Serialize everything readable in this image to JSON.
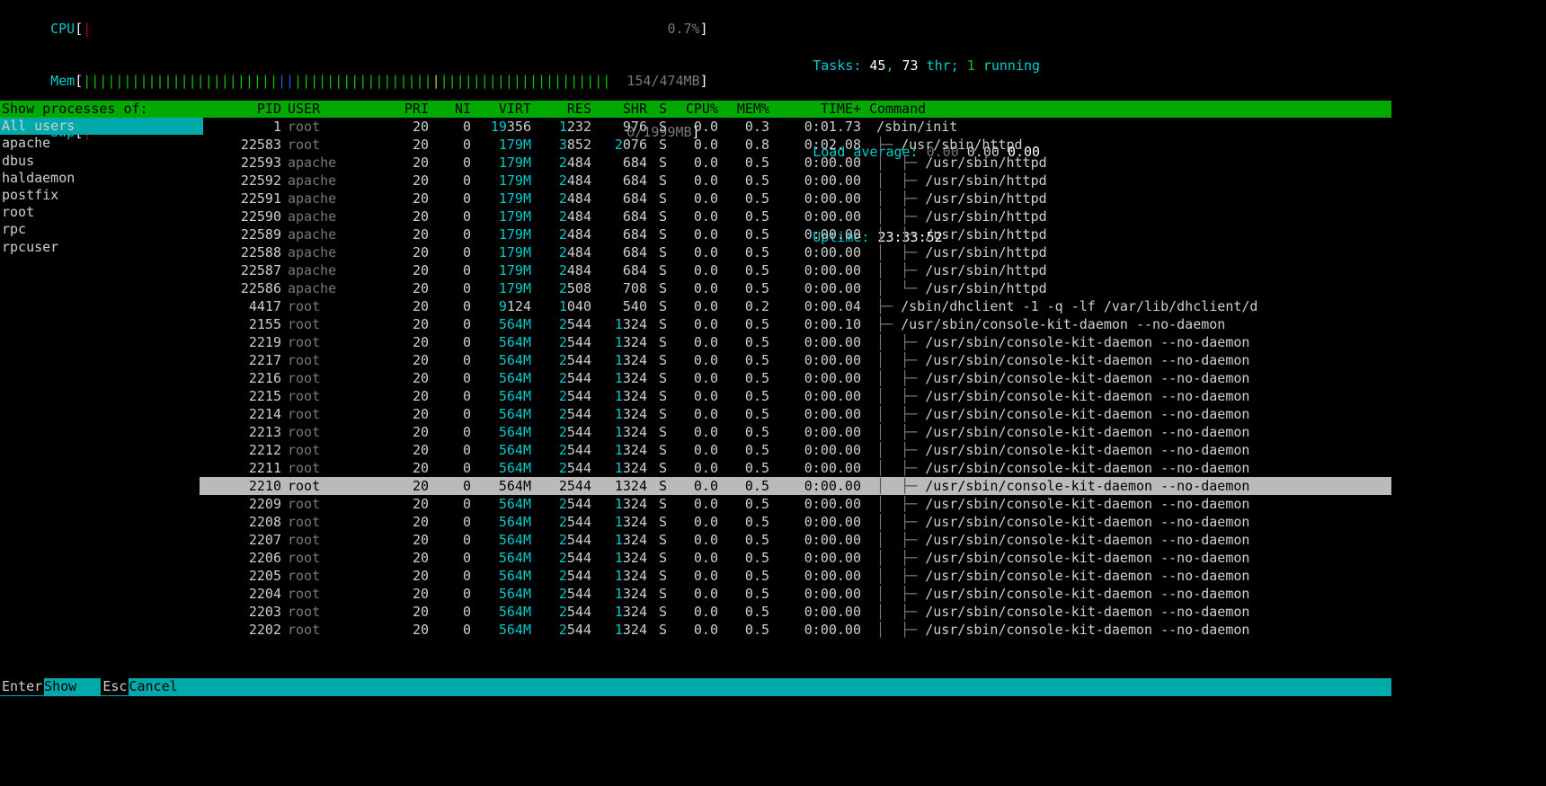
{
  "meters": {
    "cpu": {
      "label": "CPU",
      "bar": "|",
      "value": "0.7%"
    },
    "mem": {
      "label": "Mem",
      "bar": "|||||||||||||||||||||||||||||||||||||||||||||||||||||||||||||||||",
      "used": "154",
      "total": "474MB"
    },
    "swp": {
      "label": "Swp",
      "bar": "|",
      "used": "0",
      "total": "1999MB"
    }
  },
  "stats": {
    "tasks_label": "Tasks:",
    "tasks": "45",
    "thr_sep": ", ",
    "thr": "73",
    "thr_lbl": " thr; ",
    "running": "1",
    "running_lbl": " running",
    "load_label": "Load average:",
    "load1": "0.00",
    "load2": "0.00",
    "load3": "0.00",
    "uptime_label": "Uptime:",
    "uptime": "23:33:52"
  },
  "sidebar": {
    "header": "Show processes of:",
    "selected": 0,
    "items": [
      "All users",
      "apache",
      "dbus",
      "haldaemon",
      "postfix",
      "root",
      "rpc",
      "rpcuser"
    ]
  },
  "columns": [
    "PID",
    "USER",
    "PRI",
    "NI",
    "VIRT",
    "RES",
    "SHR",
    "S",
    "CPU%",
    "MEM%",
    "TIME+",
    "Command"
  ],
  "selected_row": 20,
  "processes": [
    {
      "pid": "1",
      "user": "root",
      "pri": "20",
      "ni": "0",
      "virt_hi": "19",
      "virt": "356",
      "res_hi": "1",
      "res": "232",
      "shr_hi": "",
      "shr": "976",
      "s": "S",
      "cpu": "0.0",
      "mem": "0.3",
      "time": "0:01.73",
      "tree": "",
      "cmd": "/sbin/init"
    },
    {
      "pid": "22583",
      "user": "root",
      "pri": "20",
      "ni": "0",
      "virt_hi": "",
      "virt": "179M",
      "res_hi": "3",
      "res": "852",
      "shr_hi": "2",
      "shr": "076",
      "s": "S",
      "cpu": "0.0",
      "mem": "0.8",
      "time": "0:02.08",
      "tree": "├─ ",
      "cmd": "/usr/sbin/httpd"
    },
    {
      "pid": "22593",
      "user": "apache",
      "pri": "20",
      "ni": "0",
      "virt_hi": "",
      "virt": "179M",
      "res_hi": "2",
      "res": "484",
      "shr_hi": "",
      "shr": "684",
      "s": "S",
      "cpu": "0.0",
      "mem": "0.5",
      "time": "0:00.00",
      "tree": "│  ├─ ",
      "cmd": "/usr/sbin/httpd"
    },
    {
      "pid": "22592",
      "user": "apache",
      "pri": "20",
      "ni": "0",
      "virt_hi": "",
      "virt": "179M",
      "res_hi": "2",
      "res": "484",
      "shr_hi": "",
      "shr": "684",
      "s": "S",
      "cpu": "0.0",
      "mem": "0.5",
      "time": "0:00.00",
      "tree": "│  ├─ ",
      "cmd": "/usr/sbin/httpd"
    },
    {
      "pid": "22591",
      "user": "apache",
      "pri": "20",
      "ni": "0",
      "virt_hi": "",
      "virt": "179M",
      "res_hi": "2",
      "res": "484",
      "shr_hi": "",
      "shr": "684",
      "s": "S",
      "cpu": "0.0",
      "mem": "0.5",
      "time": "0:00.00",
      "tree": "│  ├─ ",
      "cmd": "/usr/sbin/httpd"
    },
    {
      "pid": "22590",
      "user": "apache",
      "pri": "20",
      "ni": "0",
      "virt_hi": "",
      "virt": "179M",
      "res_hi": "2",
      "res": "484",
      "shr_hi": "",
      "shr": "684",
      "s": "S",
      "cpu": "0.0",
      "mem": "0.5",
      "time": "0:00.00",
      "tree": "│  ├─ ",
      "cmd": "/usr/sbin/httpd"
    },
    {
      "pid": "22589",
      "user": "apache",
      "pri": "20",
      "ni": "0",
      "virt_hi": "",
      "virt": "179M",
      "res_hi": "2",
      "res": "484",
      "shr_hi": "",
      "shr": "684",
      "s": "S",
      "cpu": "0.0",
      "mem": "0.5",
      "time": "0:00.00",
      "tree": "│  ├─ ",
      "cmd": "/usr/sbin/httpd"
    },
    {
      "pid": "22588",
      "user": "apache",
      "pri": "20",
      "ni": "0",
      "virt_hi": "",
      "virt": "179M",
      "res_hi": "2",
      "res": "484",
      "shr_hi": "",
      "shr": "684",
      "s": "S",
      "cpu": "0.0",
      "mem": "0.5",
      "time": "0:00.00",
      "tree": "│  ├─ ",
      "cmd": "/usr/sbin/httpd"
    },
    {
      "pid": "22587",
      "user": "apache",
      "pri": "20",
      "ni": "0",
      "virt_hi": "",
      "virt": "179M",
      "res_hi": "2",
      "res": "484",
      "shr_hi": "",
      "shr": "684",
      "s": "S",
      "cpu": "0.0",
      "mem": "0.5",
      "time": "0:00.00",
      "tree": "│  ├─ ",
      "cmd": "/usr/sbin/httpd"
    },
    {
      "pid": "22586",
      "user": "apache",
      "pri": "20",
      "ni": "0",
      "virt_hi": "",
      "virt": "179M",
      "res_hi": "2",
      "res": "508",
      "shr_hi": "",
      "shr": "708",
      "s": "S",
      "cpu": "0.0",
      "mem": "0.5",
      "time": "0:00.00",
      "tree": "│  └─ ",
      "cmd": "/usr/sbin/httpd"
    },
    {
      "pid": "4417",
      "user": "root",
      "pri": "20",
      "ni": "0",
      "virt_hi": "9",
      "virt": "124",
      "res_hi": "1",
      "res": "040",
      "shr_hi": "",
      "shr": "540",
      "s": "S",
      "cpu": "0.0",
      "mem": "0.2",
      "time": "0:00.04",
      "tree": "├─ ",
      "cmd": "/sbin/dhclient -1 -q -lf /var/lib/dhclient/d"
    },
    {
      "pid": "2155",
      "user": "root",
      "pri": "20",
      "ni": "0",
      "virt_hi": "",
      "virt": "564M",
      "res_hi": "2",
      "res": "544",
      "shr_hi": "1",
      "shr": "324",
      "s": "S",
      "cpu": "0.0",
      "mem": "0.5",
      "time": "0:00.10",
      "tree": "├─ ",
      "cmd": "/usr/sbin/console-kit-daemon --no-daemon"
    },
    {
      "pid": "2219",
      "user": "root",
      "pri": "20",
      "ni": "0",
      "virt_hi": "",
      "virt": "564M",
      "res_hi": "2",
      "res": "544",
      "shr_hi": "1",
      "shr": "324",
      "s": "S",
      "cpu": "0.0",
      "mem": "0.5",
      "time": "0:00.00",
      "tree": "│  ├─ ",
      "cmd": "/usr/sbin/console-kit-daemon --no-daemon"
    },
    {
      "pid": "2217",
      "user": "root",
      "pri": "20",
      "ni": "0",
      "virt_hi": "",
      "virt": "564M",
      "res_hi": "2",
      "res": "544",
      "shr_hi": "1",
      "shr": "324",
      "s": "S",
      "cpu": "0.0",
      "mem": "0.5",
      "time": "0:00.00",
      "tree": "│  ├─ ",
      "cmd": "/usr/sbin/console-kit-daemon --no-daemon"
    },
    {
      "pid": "2216",
      "user": "root",
      "pri": "20",
      "ni": "0",
      "virt_hi": "",
      "virt": "564M",
      "res_hi": "2",
      "res": "544",
      "shr_hi": "1",
      "shr": "324",
      "s": "S",
      "cpu": "0.0",
      "mem": "0.5",
      "time": "0:00.00",
      "tree": "│  ├─ ",
      "cmd": "/usr/sbin/console-kit-daemon --no-daemon"
    },
    {
      "pid": "2215",
      "user": "root",
      "pri": "20",
      "ni": "0",
      "virt_hi": "",
      "virt": "564M",
      "res_hi": "2",
      "res": "544",
      "shr_hi": "1",
      "shr": "324",
      "s": "S",
      "cpu": "0.0",
      "mem": "0.5",
      "time": "0:00.00",
      "tree": "│  ├─ ",
      "cmd": "/usr/sbin/console-kit-daemon --no-daemon"
    },
    {
      "pid": "2214",
      "user": "root",
      "pri": "20",
      "ni": "0",
      "virt_hi": "",
      "virt": "564M",
      "res_hi": "2",
      "res": "544",
      "shr_hi": "1",
      "shr": "324",
      "s": "S",
      "cpu": "0.0",
      "mem": "0.5",
      "time": "0:00.00",
      "tree": "│  ├─ ",
      "cmd": "/usr/sbin/console-kit-daemon --no-daemon"
    },
    {
      "pid": "2213",
      "user": "root",
      "pri": "20",
      "ni": "0",
      "virt_hi": "",
      "virt": "564M",
      "res_hi": "2",
      "res": "544",
      "shr_hi": "1",
      "shr": "324",
      "s": "S",
      "cpu": "0.0",
      "mem": "0.5",
      "time": "0:00.00",
      "tree": "│  ├─ ",
      "cmd": "/usr/sbin/console-kit-daemon --no-daemon"
    },
    {
      "pid": "2212",
      "user": "root",
      "pri": "20",
      "ni": "0",
      "virt_hi": "",
      "virt": "564M",
      "res_hi": "2",
      "res": "544",
      "shr_hi": "1",
      "shr": "324",
      "s": "S",
      "cpu": "0.0",
      "mem": "0.5",
      "time": "0:00.00",
      "tree": "│  ├─ ",
      "cmd": "/usr/sbin/console-kit-daemon --no-daemon"
    },
    {
      "pid": "2211",
      "user": "root",
      "pri": "20",
      "ni": "0",
      "virt_hi": "",
      "virt": "564M",
      "res_hi": "2",
      "res": "544",
      "shr_hi": "1",
      "shr": "324",
      "s": "S",
      "cpu": "0.0",
      "mem": "0.5",
      "time": "0:00.00",
      "tree": "│  ├─ ",
      "cmd": "/usr/sbin/console-kit-daemon --no-daemon"
    },
    {
      "pid": "2210",
      "user": "root",
      "pri": "20",
      "ni": "0",
      "virt_hi": "",
      "virt": "564M",
      "res_hi": "2",
      "res": "544",
      "shr_hi": "1",
      "shr": "324",
      "s": "S",
      "cpu": "0.0",
      "mem": "0.5",
      "time": "0:00.00",
      "tree": "│  ├─ ",
      "cmd": "/usr/sbin/console-kit-daemon --no-daemon"
    },
    {
      "pid": "2209",
      "user": "root",
      "pri": "20",
      "ni": "0",
      "virt_hi": "",
      "virt": "564M",
      "res_hi": "2",
      "res": "544",
      "shr_hi": "1",
      "shr": "324",
      "s": "S",
      "cpu": "0.0",
      "mem": "0.5",
      "time": "0:00.00",
      "tree": "│  ├─ ",
      "cmd": "/usr/sbin/console-kit-daemon --no-daemon"
    },
    {
      "pid": "2208",
      "user": "root",
      "pri": "20",
      "ni": "0",
      "virt_hi": "",
      "virt": "564M",
      "res_hi": "2",
      "res": "544",
      "shr_hi": "1",
      "shr": "324",
      "s": "S",
      "cpu": "0.0",
      "mem": "0.5",
      "time": "0:00.00",
      "tree": "│  ├─ ",
      "cmd": "/usr/sbin/console-kit-daemon --no-daemon"
    },
    {
      "pid": "2207",
      "user": "root",
      "pri": "20",
      "ni": "0",
      "virt_hi": "",
      "virt": "564M",
      "res_hi": "2",
      "res": "544",
      "shr_hi": "1",
      "shr": "324",
      "s": "S",
      "cpu": "0.0",
      "mem": "0.5",
      "time": "0:00.00",
      "tree": "│  ├─ ",
      "cmd": "/usr/sbin/console-kit-daemon --no-daemon"
    },
    {
      "pid": "2206",
      "user": "root",
      "pri": "20",
      "ni": "0",
      "virt_hi": "",
      "virt": "564M",
      "res_hi": "2",
      "res": "544",
      "shr_hi": "1",
      "shr": "324",
      "s": "S",
      "cpu": "0.0",
      "mem": "0.5",
      "time": "0:00.00",
      "tree": "│  ├─ ",
      "cmd": "/usr/sbin/console-kit-daemon --no-daemon"
    },
    {
      "pid": "2205",
      "user": "root",
      "pri": "20",
      "ni": "0",
      "virt_hi": "",
      "virt": "564M",
      "res_hi": "2",
      "res": "544",
      "shr_hi": "1",
      "shr": "324",
      "s": "S",
      "cpu": "0.0",
      "mem": "0.5",
      "time": "0:00.00",
      "tree": "│  ├─ ",
      "cmd": "/usr/sbin/console-kit-daemon --no-daemon"
    },
    {
      "pid": "2204",
      "user": "root",
      "pri": "20",
      "ni": "0",
      "virt_hi": "",
      "virt": "564M",
      "res_hi": "2",
      "res": "544",
      "shr_hi": "1",
      "shr": "324",
      "s": "S",
      "cpu": "0.0",
      "mem": "0.5",
      "time": "0:00.00",
      "tree": "│  ├─ ",
      "cmd": "/usr/sbin/console-kit-daemon --no-daemon"
    },
    {
      "pid": "2203",
      "user": "root",
      "pri": "20",
      "ni": "0",
      "virt_hi": "",
      "virt": "564M",
      "res_hi": "2",
      "res": "544",
      "shr_hi": "1",
      "shr": "324",
      "s": "S",
      "cpu": "0.0",
      "mem": "0.5",
      "time": "0:00.00",
      "tree": "│  ├─ ",
      "cmd": "/usr/sbin/console-kit-daemon --no-daemon"
    },
    {
      "pid": "2202",
      "user": "root",
      "pri": "20",
      "ni": "0",
      "virt_hi": "",
      "virt": "564M",
      "res_hi": "2",
      "res": "544",
      "shr_hi": "1",
      "shr": "324",
      "s": "S",
      "cpu": "0.0",
      "mem": "0.5",
      "time": "0:00.00",
      "tree": "│  ├─ ",
      "cmd": "/usr/sbin/console-kit-daemon --no-daemon"
    }
  ],
  "footer": {
    "enter_key": "Enter",
    "enter_label": "Show   ",
    "esc_key": "Esc",
    "esc_label": "Cancel"
  }
}
